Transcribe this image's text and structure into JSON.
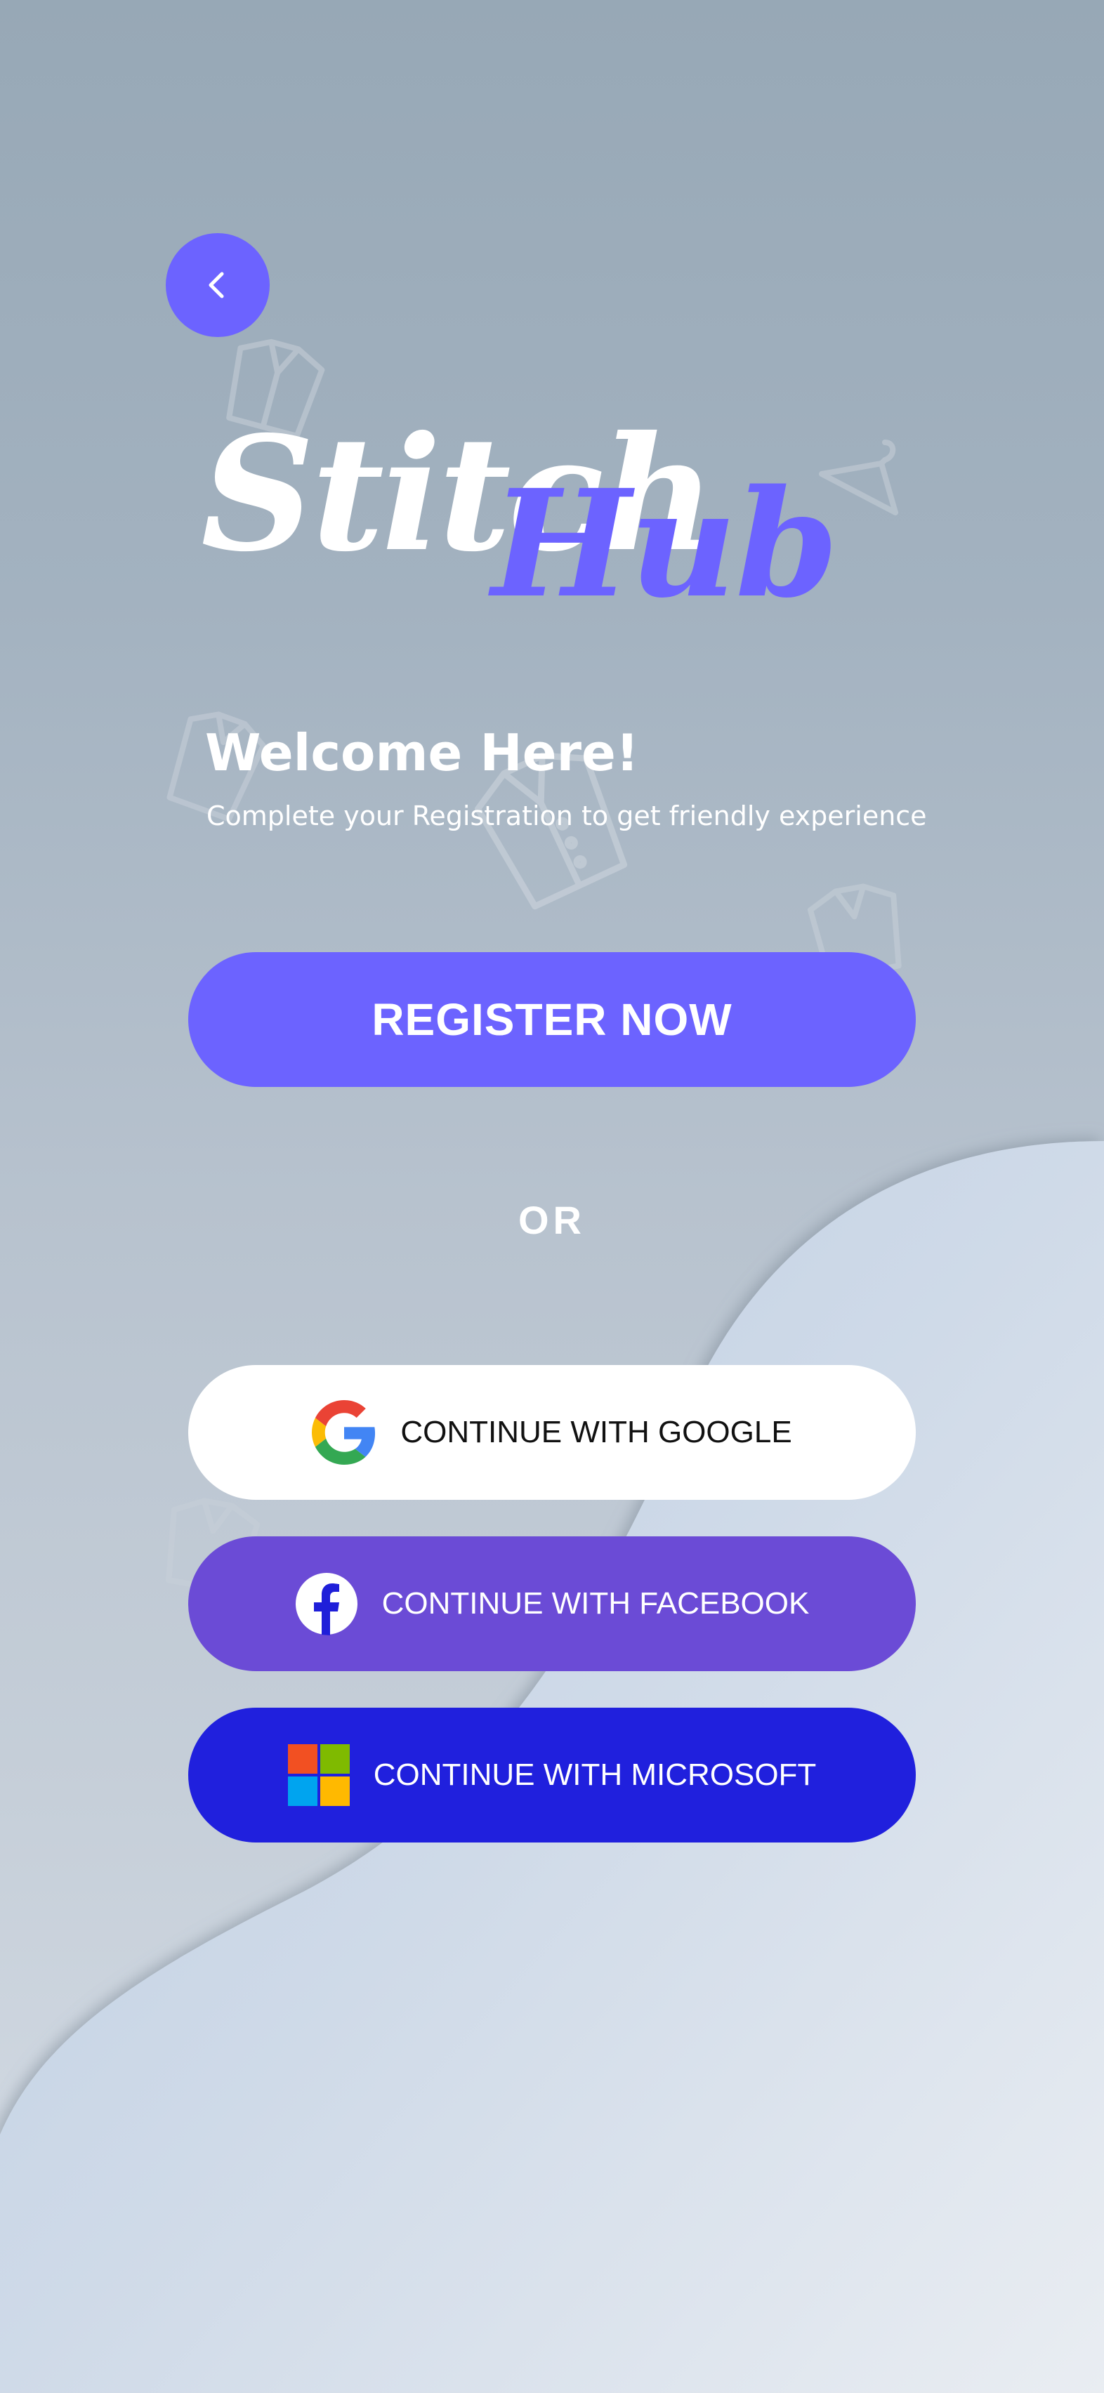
{
  "logo": {
    "word1": "Stitch",
    "word2": "Hub"
  },
  "welcome": {
    "title": "Welcome Here!",
    "subtitle": "Complete your Registration to get friendly experience"
  },
  "register_button": {
    "label": "REGISTER NOW"
  },
  "divider": {
    "label": "OR"
  },
  "social": {
    "google": {
      "label": "CONTINUE WITH GOOGLE",
      "icon": "google-icon"
    },
    "facebook": {
      "label": "CONTINUE WITH FACEBOOK",
      "icon": "facebook-icon"
    },
    "microsoft": {
      "label": "CONTINUE WITH MICROSOFT",
      "icon": "microsoft-icon"
    }
  },
  "colors": {
    "accent": "#6c63ff",
    "facebook_button": "#6b4bd6",
    "microsoft_button": "#2020dd",
    "background_top": "#97a8b6",
    "background_bottom": "#d6dde6"
  }
}
